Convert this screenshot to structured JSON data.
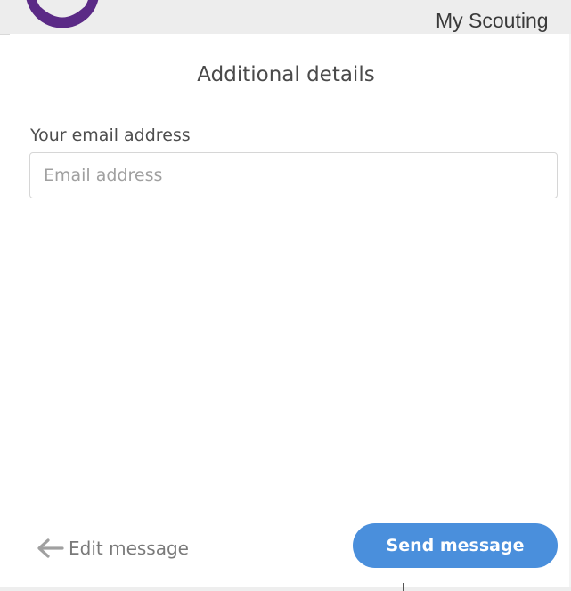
{
  "background_site": {
    "title": "My Scouting",
    "logo_icon": "scout-logo-icon",
    "logo_color": "#5b2a86"
  },
  "panel": {
    "title": "Additional details",
    "email_field": {
      "label": "Your email address",
      "placeholder": "Email address",
      "value": ""
    },
    "footer": {
      "back_icon": "arrow-left-icon",
      "back_label": "Edit message",
      "send_label": "Send message"
    }
  },
  "colors": {
    "accent": "#4a8fdc",
    "brand": "#5b2a86"
  }
}
